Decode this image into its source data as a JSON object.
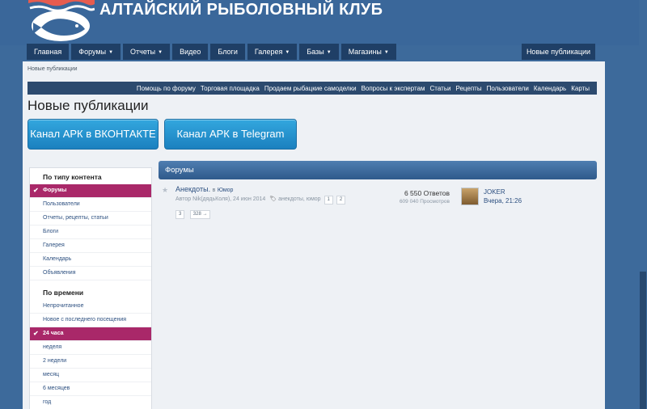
{
  "site": {
    "title": "АЛТАЙСКИЙ РЫБОЛОВНЫЙ КЛУБ"
  },
  "main_nav": [
    {
      "label": "Главная",
      "dropdown": false
    },
    {
      "label": "Форумы",
      "dropdown": true
    },
    {
      "label": "Отчеты",
      "dropdown": true
    },
    {
      "label": "Видео",
      "dropdown": false
    },
    {
      "label": "Блоги",
      "dropdown": false
    },
    {
      "label": "Галерея",
      "dropdown": true
    },
    {
      "label": "Базы",
      "dropdown": true
    },
    {
      "label": "Магазины",
      "dropdown": true
    }
  ],
  "new_publications_button": "Новые публикации",
  "breadcrumb": "Новые публикации",
  "sub_nav": [
    "Помощь по форуму",
    "Торговая площадка",
    "Продаем рыбацкие самоделки",
    "Вопросы к экспертам",
    "Статьи",
    "Рецепты",
    "Пользователи",
    "Календарь",
    "Карты"
  ],
  "page_title": "Новые публикации",
  "channels": {
    "vk": "Канал АРК в ВКОНТАКТЕ",
    "telegram": "Канал АРК в Telegram"
  },
  "sidebar": {
    "by_type_heading": "По типу контента",
    "by_type": [
      {
        "label": "Форумы",
        "active": true
      },
      {
        "label": "Пользователи",
        "active": false
      },
      {
        "label": "Отчеты, рецепты, статьи",
        "active": false
      },
      {
        "label": "Блоги",
        "active": false
      },
      {
        "label": "Галерея",
        "active": false
      },
      {
        "label": "Календарь",
        "active": false
      },
      {
        "label": "Объявления",
        "active": false
      }
    ],
    "by_time_heading": "По времени",
    "by_time": [
      {
        "label": "Непрочитанное",
        "active": false
      },
      {
        "label": "Новое с последнего посещения",
        "active": false
      },
      {
        "label": "24 часа",
        "active": true
      },
      {
        "label": "неделя",
        "active": false
      },
      {
        "label": "2 недели",
        "active": false
      },
      {
        "label": "месяц",
        "active": false
      },
      {
        "label": "6 месяцев",
        "active": false
      },
      {
        "label": "год",
        "active": false
      }
    ]
  },
  "results": {
    "heading": "Форумы",
    "topics": [
      {
        "title": "Анекдоты.",
        "in_label": "в",
        "forum": "Юмор",
        "author_line": "Автор Nik(дядьКоля), 24 июн 2014",
        "tags": "анекдоты, юмор",
        "pages": [
          "1",
          "2",
          "3",
          "328 →"
        ],
        "replies": "6 550 Ответов",
        "views": "609 040 Просмотров",
        "last_user": "JOKER",
        "last_time": "Вчера, 21:26"
      }
    ]
  },
  "colors": {
    "header_bg": "#3a679a",
    "nav_bg": "#1f3f66",
    "active_item": "#a92869",
    "channel_button": "#1b80bf"
  }
}
